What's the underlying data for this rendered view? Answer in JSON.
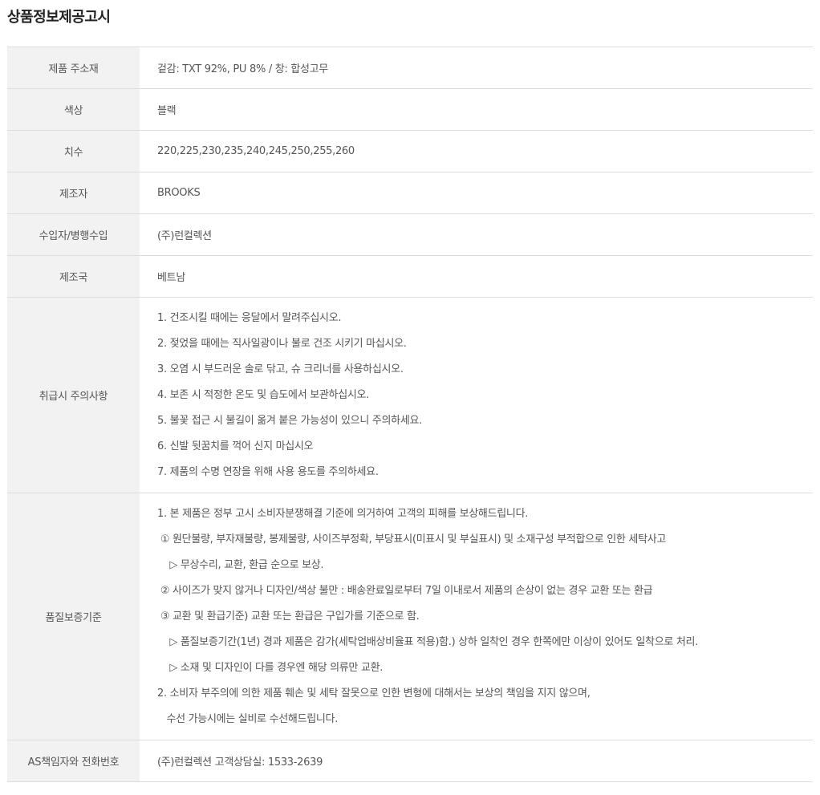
{
  "title": "상품정보제공고시",
  "rows": {
    "material": {
      "label": "제품 주소재",
      "value": "겉감: TXT 92%, PU 8% / 창: 합성고무"
    },
    "color": {
      "label": "색상",
      "value": "블랙"
    },
    "size": {
      "label": "치수",
      "value": "220,225,230,235,240,245,250,255,260"
    },
    "maker": {
      "label": "제조자",
      "value": "BROOKS"
    },
    "importer": {
      "label": "수입자/병행수입",
      "value": "(주)런컬렉션"
    },
    "country": {
      "label": "제조국",
      "value": "베트남"
    },
    "care": {
      "label": "취급시 주의사항",
      "lines": [
        "1. 건조시킬 때에는 응달에서 말려주십시오.",
        "2. 젖었을 때에는 직사일광이나 불로 건조 시키기 마십시오.",
        "3. 오염 시 부드러운 솔로 닦고, 슈 크리너를 사용하십시오.",
        "4. 보존 시 적정한 온도 및 습도에서 보관하십시오.",
        "5. 불꽃 접근 시 불길이 옮겨 붙은 가능성이 있으니 주의하세요.",
        "6. 신발 뒷꿈치를 꺽어 신지 마십시오",
        "7. 제품의 수명 연장을 위해 사용 용도를 주의하세요."
      ]
    },
    "quality": {
      "label": "품질보증기준",
      "lines": [
        "1. 본 제품은 정부 고시 소비자분쟁해결 기준에 의거하여 고객의 피해를 보상해드립니다.",
        " ① 원단불량, 부자재불량, 봉제불량, 사이즈부정확, 부당표시(미표시 및 부실표시) 및 소재구성 부적합으로 인한 세탁사고",
        "    ▷ 무상수리, 교환, 환급 순으로 보상.",
        " ② 사이즈가 맞지 않거나 디자인/색상 불만 : 배송완료일로부터 7일 이내로서 제품의 손상이 없는 경우 교환 또는 환급",
        " ③ 교환 및 환급기준) 교환 또는 환급은 구입가를 기준으로 함.",
        "    ▷ 품질보증기간(1년) 경과 제품은 감가(세탁업배상비율표 적용)함.) 상하 일착인 경우 한쪽에만 이상이 있어도 일착으로 처리.",
        "    ▷ 소재 및 디자인이 다를 경우엔 해당 의류만 교환.",
        "2. 소비자 부주의에 의한 제품 훼손 및 세탁 잘못으로 인한 변형에 대해서는 보상의 책임을 지지 않으며,",
        "   수선 가능시에는 실비로 수선해드립니다."
      ]
    },
    "as": {
      "label": "AS책임자와 전화번호",
      "value": "(주)런컬렉션 고객상담실: 1533-2639"
    }
  }
}
